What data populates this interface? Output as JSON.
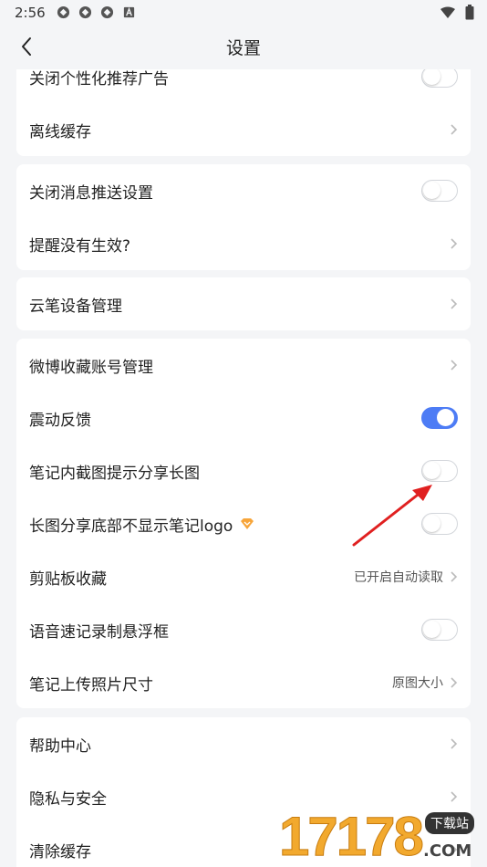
{
  "status_bar": {
    "time": "2:56"
  },
  "header": {
    "title": "设置",
    "back_icon": "chevron-left-icon"
  },
  "groups": [
    {
      "items": [
        {
          "label": "关闭个性化推荐广告",
          "control": "toggle",
          "on": false
        },
        {
          "label": "离线缓存",
          "control": "chevron"
        }
      ]
    },
    {
      "items": [
        {
          "label": "关闭消息推送设置",
          "control": "toggle",
          "on": false
        },
        {
          "label": "提醒没有生效?",
          "control": "chevron"
        }
      ]
    },
    {
      "items": [
        {
          "label": "云笔设备管理",
          "control": "chevron"
        }
      ]
    },
    {
      "items": [
        {
          "label": "微博收藏账号管理",
          "control": "chevron"
        },
        {
          "label": "震动反馈",
          "control": "toggle",
          "on": true
        },
        {
          "label": "笔记内截图提示分享长图",
          "control": "toggle",
          "on": false
        },
        {
          "label": "长图分享底部不显示笔记logo",
          "control": "toggle",
          "on": false,
          "badge": "vip-diamond-icon"
        },
        {
          "label": "剪贴板收藏",
          "control": "chevron",
          "value": "已开启自动读取"
        },
        {
          "label": "语音速记录制悬浮框",
          "control": "toggle",
          "on": false
        },
        {
          "label": "笔记上传照片尺寸",
          "control": "chevron",
          "value": "原图大小"
        }
      ]
    },
    {
      "items": [
        {
          "label": "帮助中心",
          "control": "chevron"
        },
        {
          "label": "隐私与安全",
          "control": "chevron"
        },
        {
          "label": "清除缓存",
          "control": "chevron"
        }
      ]
    }
  ],
  "watermark": {
    "number": "17178",
    "badge": "下载站",
    "domain": ".COM"
  },
  "colors": {
    "accent": "#4d7cf5",
    "arrow": "#e02020"
  }
}
